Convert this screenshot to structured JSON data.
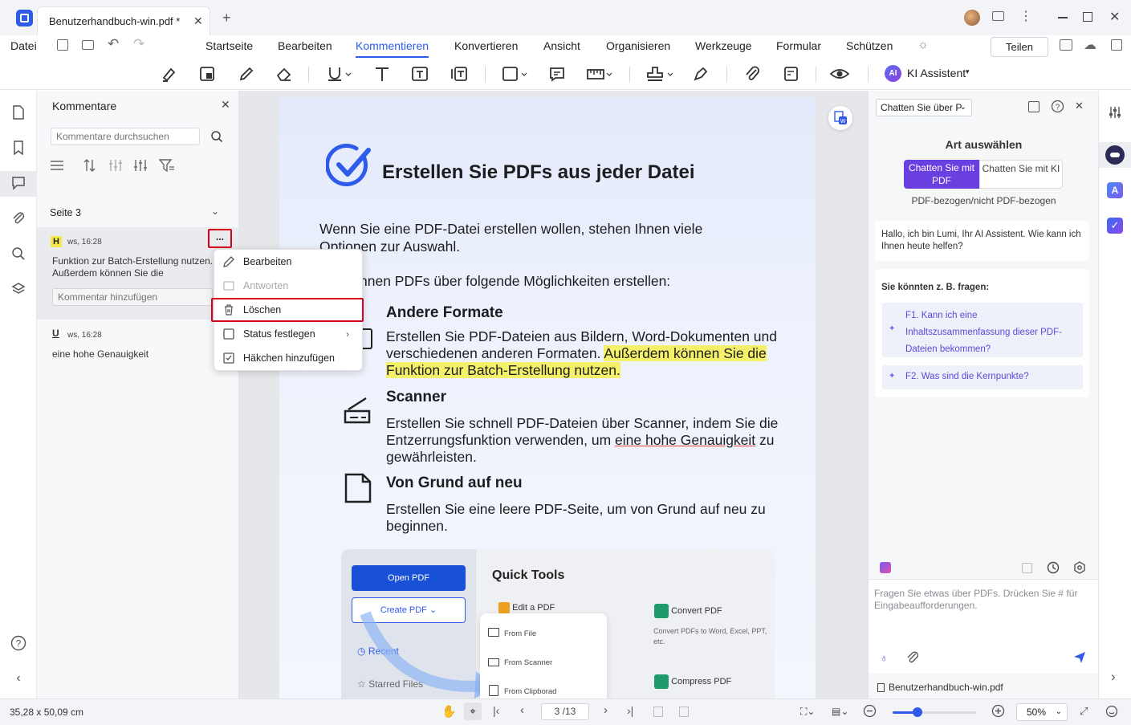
{
  "titlebar": {
    "tab_title": "Benutzerhandbuch-win.pdf *",
    "new_tab": "+"
  },
  "menubar": {
    "datei": "Datei",
    "items": [
      "Startseite",
      "Bearbeiten",
      "Kommentieren",
      "Konvertieren",
      "Ansicht",
      "Organisieren",
      "Werkzeuge",
      "Formular",
      "Schützen"
    ],
    "active": "Kommentieren",
    "share": "Teilen"
  },
  "toolbar": {
    "ai_badge": "AI",
    "ai_label": "KI Assistent"
  },
  "comments_panel": {
    "title": "Kommentare",
    "search_placeholder": "Kommentare durchsuchen",
    "page_label": "Seite 3",
    "comment1": {
      "badge": "H",
      "meta": "ws, 16:28",
      "text": "Funktion zur Batch-Erstellung nutzen. Außerdem können Sie die",
      "reply_placeholder": "Kommentar hinzufügen",
      "more": "..."
    },
    "comment2": {
      "badge": "U",
      "meta": "ws, 16:28",
      "text": "eine hohe Genauigkeit"
    }
  },
  "context_menu": {
    "edit": "Bearbeiten",
    "reply": "Antworten",
    "delete": "Löschen",
    "status": "Status festlegen",
    "checkmark": "Häkchen hinzufügen"
  },
  "document": {
    "heading": "Erstellen Sie PDFs aus jeder Datei",
    "intro_line1": "Wenn Sie eine PDF-Datei erstellen wollen, stehen Ihnen viele",
    "intro_line2": "Optionen zur Auswahl.",
    "sub_intro": "nnen PDFs über folgende Möglichkeiten erstellen:",
    "sec1_title": "Andere Formate",
    "sec1_line1": "Erstellen Sie PDF-Dateien aus Bildern, Word-Dokumenten und",
    "sec1_line2a": "verschiedenen Formaten. ",
    "sec1_line2_prefix": "verschiedenen anderen Formaten. ",
    "sec1_hl1": "Außerdem können Sie die",
    "sec1_hl2": "Funktion zur Batch-Erstellung nutzen.",
    "sec2_title": "Scanner",
    "sec2_line1": "Erstellen Sie schnell PDF-Dateien über Scanner, indem Sie die",
    "sec2_line2a": "Entzerrungsfunktion verwenden, um ",
    "sec2_ul": "eine hohe Genauigkeit",
    "sec2_line2b": " zu",
    "sec2_line3": "gewährleisten.",
    "sec3_title": "Von Grund auf neu",
    "sec3_line1": "Erstellen Sie eine leere PDF-Seite, um von Grund auf neu zu",
    "sec3_line2": "beginnen.",
    "shot": {
      "open_pdf": "Open PDF",
      "create_pdf": "Create PDF",
      "recent": "Recent",
      "starred": "Starred Files",
      "quick_tools": "Quick Tools",
      "edit_pdf": "Edit a PDF",
      "convert_pdf": "Convert PDF",
      "convert_desc": "Convert PDFs to Word, Excel, PPT, etc.",
      "compress_pdf": "Compress PDF",
      "from_file": "From File",
      "from_scanner": "From Scanner",
      "from_clipboard": "From Clipborad"
    }
  },
  "ai_panel": {
    "dropdown": "Chatten Sie über P",
    "art_title": "Art auswählen",
    "btn_pdf": "Chatten Sie mit PDF",
    "btn_ki": "Chatten Sie mit KI",
    "sub": "PDF-bezogen/nicht PDF-bezogen",
    "greeting": "Hallo, ich bin Lumi, Ihr AI Assistent. Wie kann ich Ihnen heute helfen?",
    "ask_title": "Sie könnten z. B. fragen:",
    "q1": "F1. Kann ich eine Inhaltszusammenfassung dieser PDF-Dateien bekommen?",
    "q2": "F2. Was sind die Kernpunkte?",
    "input_placeholder": "Fragen Sie etwas über PDFs. Drücken Sie # für Eingabeaufforderungen.",
    "file": "Benutzerhandbuch-win.pdf"
  },
  "statusbar": {
    "dimensions": "35,28 x 50,09 cm",
    "page": "3 /13",
    "zoom": "50%",
    "zoom_level": 0.22
  },
  "colors": {
    "accent": "#2f5bea",
    "highlight": "#f5f06a",
    "red_box": "#d9001b",
    "ai_purple": "#6a3fe0"
  }
}
